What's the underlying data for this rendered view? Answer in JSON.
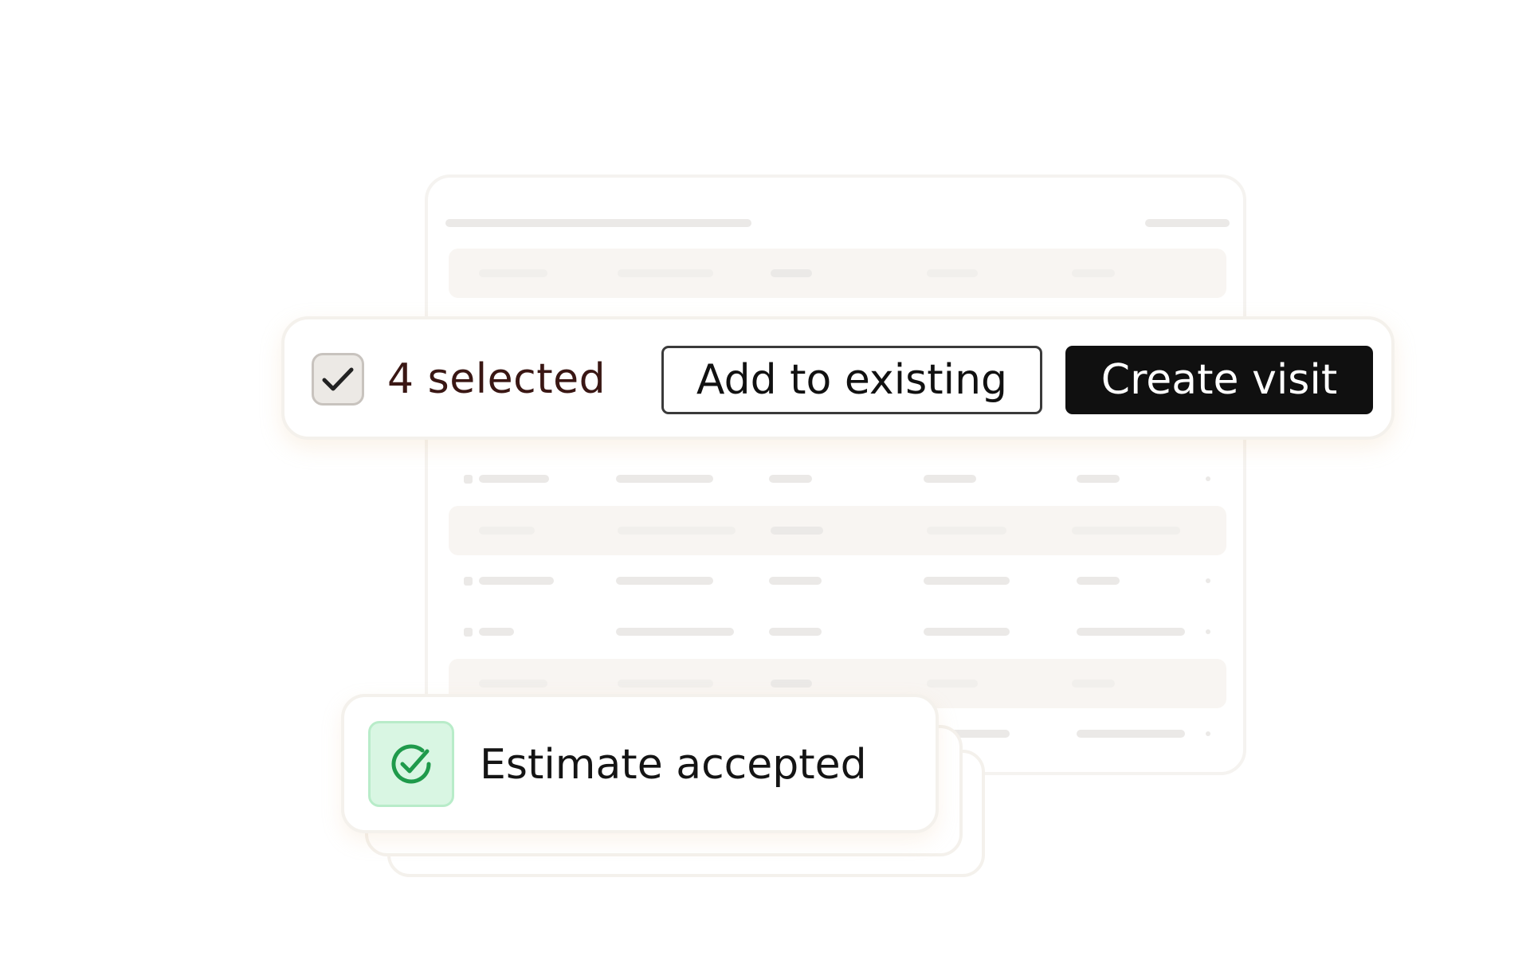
{
  "selection_bar": {
    "selected_count_label": "4 selected",
    "checkbox_checked": true,
    "add_to_existing_label": "Add to existing",
    "create_visit_label": "Create visit"
  },
  "toast": {
    "message": "Estimate accepted",
    "icon": "check-circle-icon",
    "icon_color": "#1f9a4b",
    "icon_background": "#d9f6e3"
  },
  "colors": {
    "primary_button": "#101010",
    "selected_count_text": "#3a1714"
  }
}
